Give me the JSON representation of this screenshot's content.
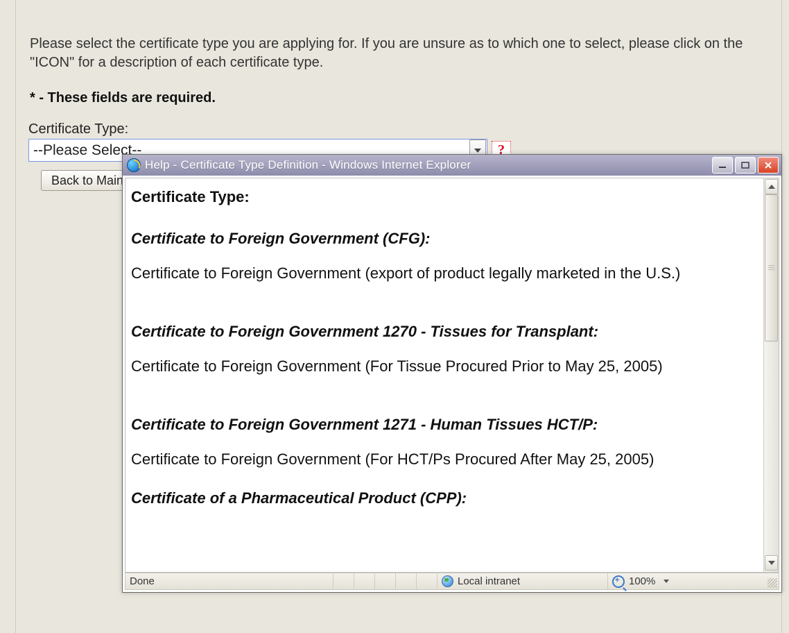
{
  "page": {
    "instruction": "Please select the certificate type you are applying for. If you are unsure as to which one to select, please click on the \"ICON\" for a description of each certificate type.",
    "required_note": "* - These fields are required.",
    "cert_type_label": "Certificate Type:",
    "cert_type_value": "--Please Select--",
    "back_button": "Back to Main"
  },
  "popup": {
    "title": "Help - Certificate Type Definition - Windows Internet Explorer",
    "heading": "Certificate Type:",
    "sections": [
      {
        "title": "Certificate to Foreign Government (CFG):",
        "body": "Certificate to Foreign Government (export of product legally marketed in the U.S.)"
      },
      {
        "title": "Certificate to Foreign Government 1270 - Tissues for Transplant:",
        "body": "Certificate to Foreign Government (For Tissue Procured Prior to May 25, 2005)"
      },
      {
        "title": "Certificate to Foreign Government 1271 - Human Tissues HCT/P:",
        "body": "Certificate to Foreign Government (For HCT/Ps Procured After May 25, 2005)"
      },
      {
        "title": "Certificate of a Pharmaceutical Product (CPP):",
        "body": ""
      }
    ],
    "status_done": "Done",
    "status_zone": "Local intranet",
    "status_zoom": "100%"
  }
}
